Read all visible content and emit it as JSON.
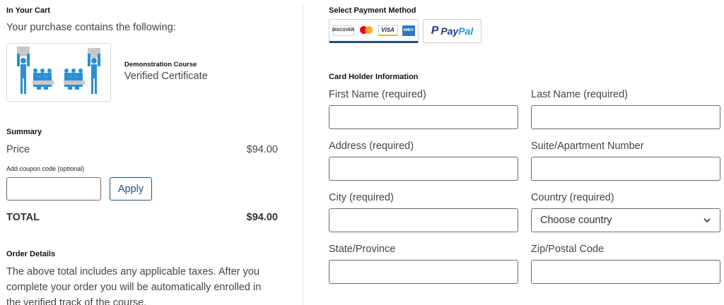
{
  "cart": {
    "title": "In Your Cart",
    "intro": "Your purchase contains the following:",
    "course_name": "Demonstration Course",
    "course_type": "Verified Certificate"
  },
  "summary": {
    "title": "Summary",
    "price_label": "Price",
    "price_value": "$94.00",
    "coupon_label": "Add coupon code (optional)",
    "coupon_value": "",
    "apply_label": "Apply",
    "total_label": "TOTAL",
    "total_value": "$94.00"
  },
  "order_details": {
    "title": "Order Details",
    "text": "The above total includes any applicable taxes. After you complete your order you will be automatically enrolled in the verified track of the course."
  },
  "payment": {
    "title": "Select Payment Method",
    "card_logos": [
      "DISCOVER",
      "mastercard",
      "VISA",
      "AMEX"
    ],
    "paypal_label_pay": "Pay",
    "paypal_label_pal": "Pal",
    "selected": "card",
    "accent_color": "#1f4e7a"
  },
  "card_holder": {
    "title": "Card Holder Information",
    "first_name_label": "First Name (required)",
    "last_name_label": "Last Name (required)",
    "address_label": "Address (required)",
    "suite_label": "Suite/Apartment Number",
    "city_label": "City (required)",
    "country_label": "Country (required)",
    "country_value": "Choose country",
    "state_label": "State/Province",
    "zip_label": "Zip/Postal Code"
  }
}
